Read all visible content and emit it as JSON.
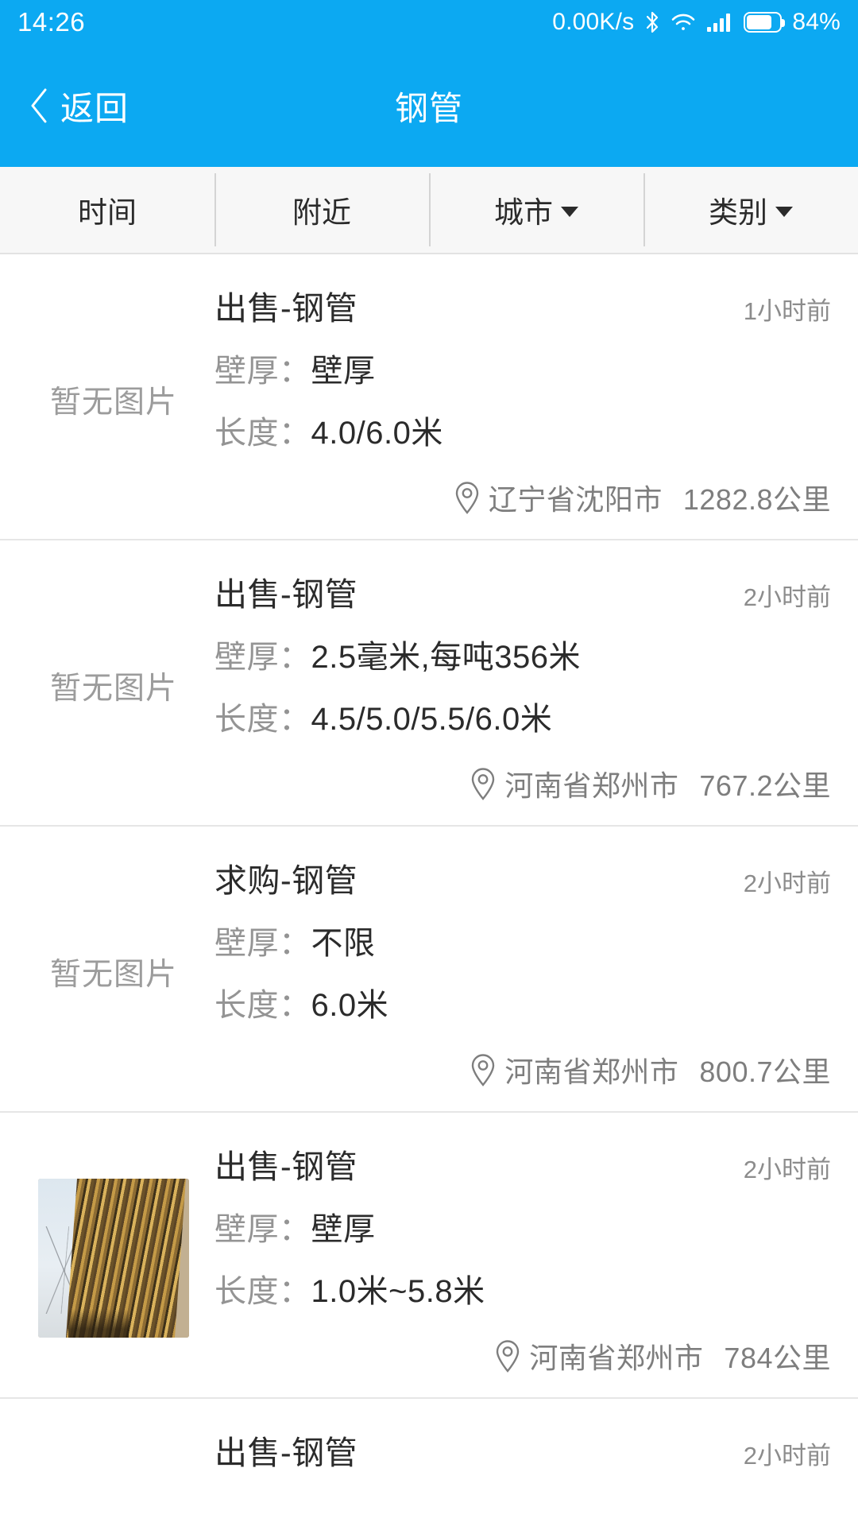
{
  "status_bar": {
    "time": "14:26",
    "network_speed": "0.00K/s",
    "battery_percent": "84%",
    "icons": [
      "bluetooth-icon",
      "wifi-icon",
      "signal-icon",
      "battery-icon"
    ]
  },
  "nav_bar": {
    "back_label": "返回",
    "title": "钢管",
    "back_icon": "chevron-left-icon"
  },
  "filter_bar": {
    "tabs": [
      {
        "label": "时间",
        "has_caret": false
      },
      {
        "label": "附近",
        "has_caret": false
      },
      {
        "label": "城市",
        "has_caret": true
      },
      {
        "label": "类别",
        "has_caret": true
      }
    ]
  },
  "colors": {
    "accent": "#0CA9F2",
    "tab_bg": "#f7f7f7",
    "text_primary": "#2b2b2b",
    "text_secondary": "#949494",
    "divider": "#e6e6e6"
  },
  "list": {
    "no_image_text": "暂无图片",
    "thickness_label": "壁厚：",
    "length_label": "长度：",
    "items": [
      {
        "title": "出售-钢管",
        "time": "1小时前",
        "thickness": "壁厚",
        "length": "4.0/6.0米",
        "location": "辽宁省沈阳市",
        "distance": "1282.8公里",
        "has_photo": false
      },
      {
        "title": "出售-钢管",
        "time": "2小时前",
        "thickness": "2.5毫米,每吨356米",
        "length": "4.5/5.0/5.5/6.0米",
        "location": "河南省郑州市",
        "distance": "767.2公里",
        "has_photo": false
      },
      {
        "title": "求购-钢管",
        "time": "2小时前",
        "thickness": "不限",
        "length": "6.0米",
        "location": "河南省郑州市",
        "distance": "800.7公里",
        "has_photo": false
      },
      {
        "title": "出售-钢管",
        "time": "2小时前",
        "thickness": "壁厚",
        "length": "1.0米~5.8米",
        "location": "河南省郑州市",
        "distance": "784公里",
        "has_photo": true
      },
      {
        "title": "出售-钢管",
        "time": "2小时前",
        "thickness": "",
        "length": "",
        "location": "",
        "distance": "",
        "has_photo": false
      }
    ]
  }
}
